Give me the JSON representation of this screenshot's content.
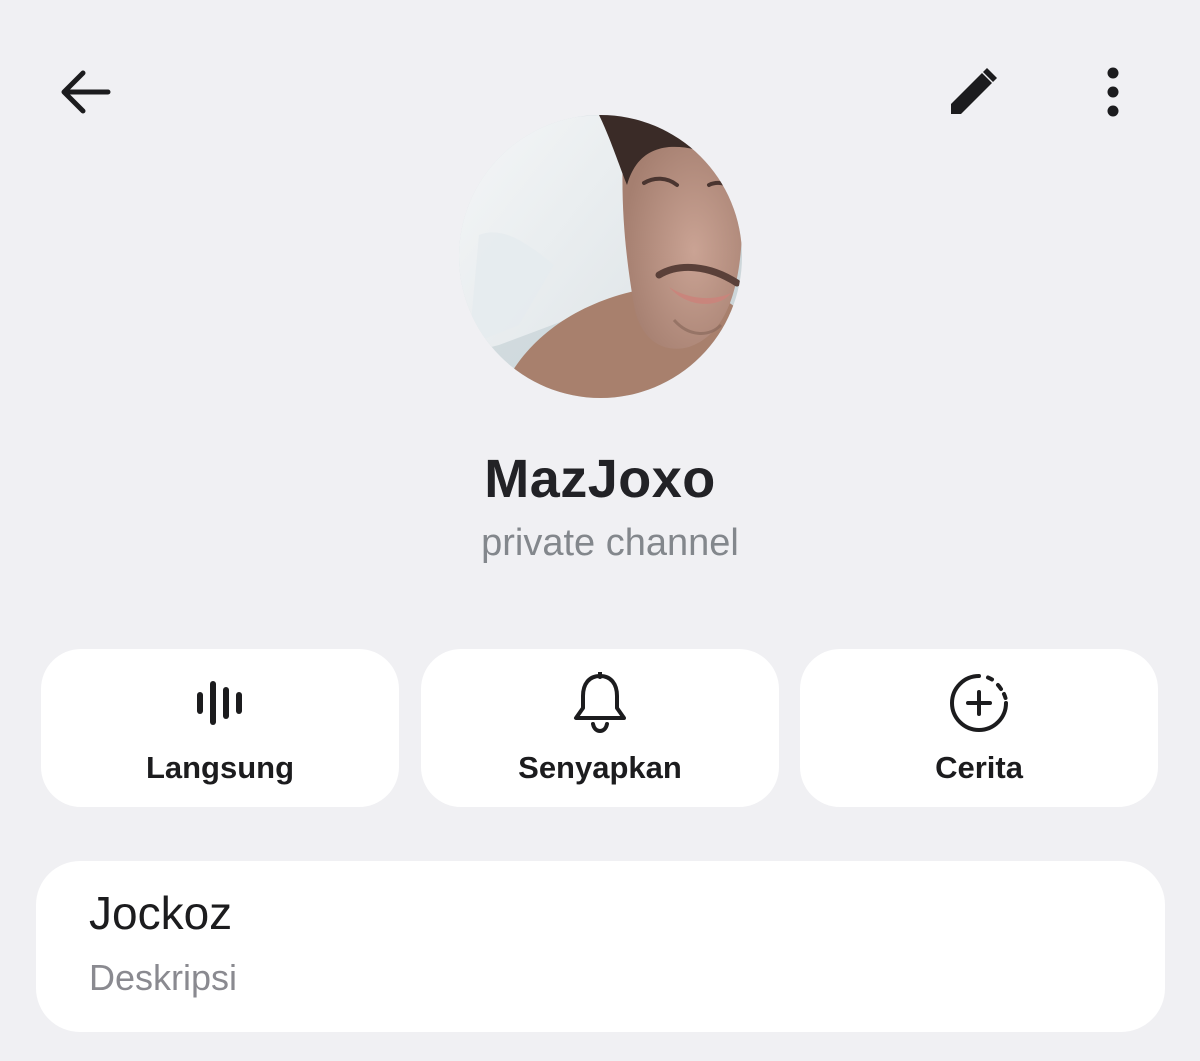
{
  "header": {
    "back_icon": "arrow-left-icon",
    "edit_icon": "pencil-icon",
    "more_icon": "more-vertical-icon"
  },
  "profile": {
    "name": "MazJoxo",
    "status": "private channel"
  },
  "actions": [
    {
      "label": "Langsung",
      "icon": "live-stream-icon"
    },
    {
      "label": "Senyapkan",
      "icon": "bell-icon"
    },
    {
      "label": "Cerita",
      "icon": "add-story-icon"
    }
  ],
  "info": {
    "title": "Jockoz",
    "subtitle": "Deskripsi"
  },
  "colors": {
    "background": "#f0f0f3",
    "card": "#ffffff",
    "text_primary": "#1c1c1e",
    "text_secondary": "#83878c"
  }
}
